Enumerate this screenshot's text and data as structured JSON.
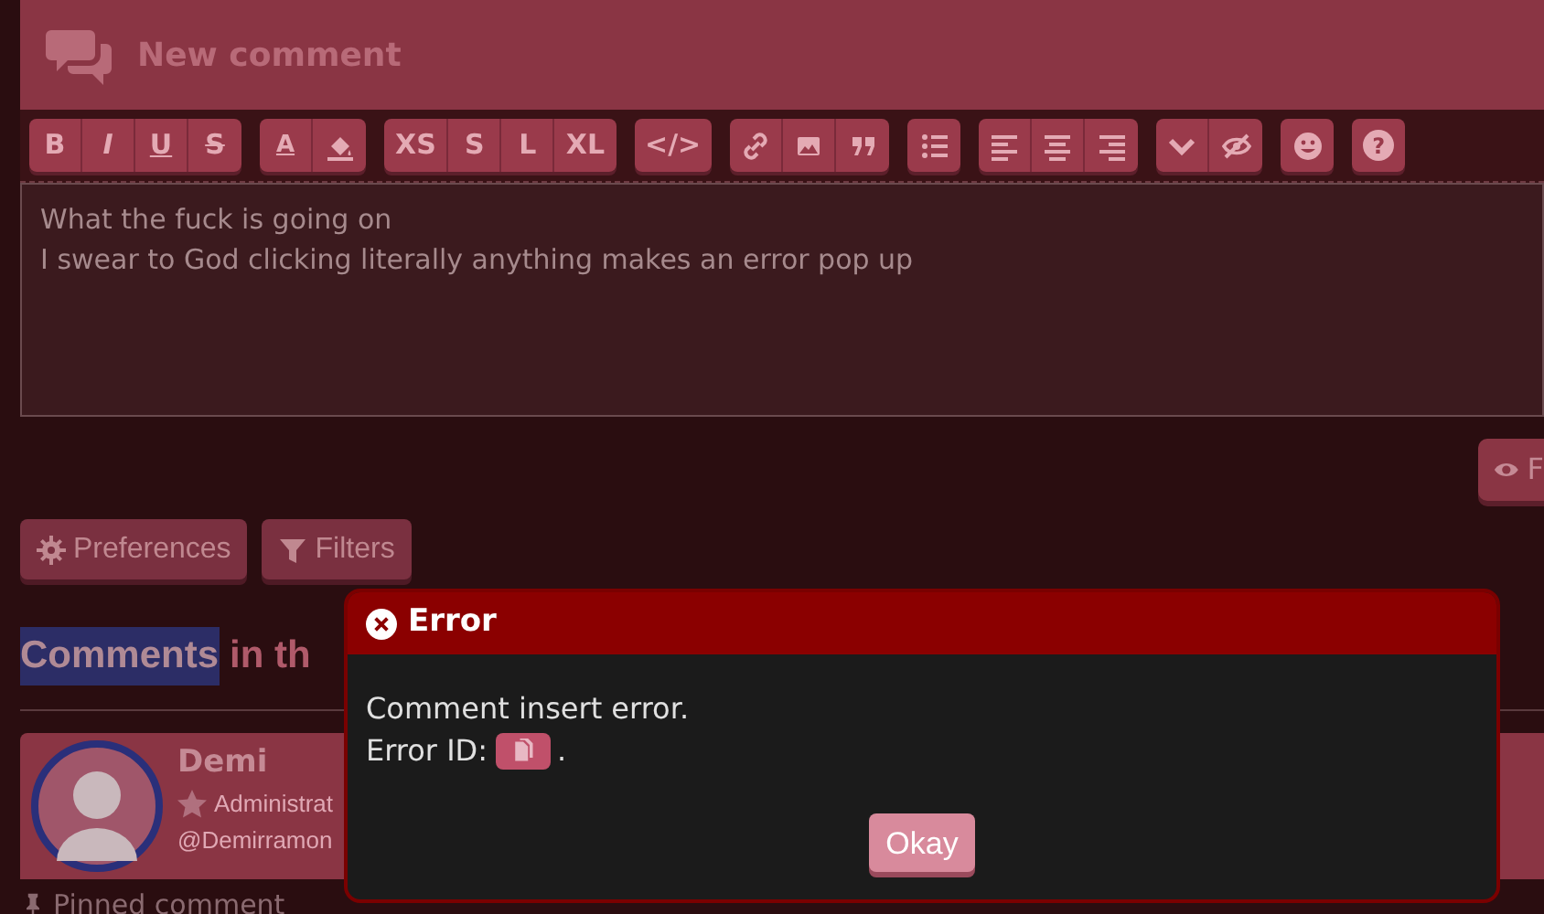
{
  "editor": {
    "title": "New comment",
    "toolbar": [
      [
        {
          "label": "B",
          "kind": "bold"
        },
        {
          "label": "I",
          "kind": "italic"
        },
        {
          "label": "U",
          "kind": "underline"
        },
        {
          "label": "S",
          "kind": "strike"
        }
      ],
      [
        {
          "label": "A",
          "kind": "color"
        },
        {
          "kind": "icon"
        }
      ],
      [
        {
          "label": "XS",
          "kind": "text"
        },
        {
          "label": "S",
          "kind": "text"
        },
        {
          "label": "L",
          "kind": "text"
        },
        {
          "label": "XL",
          "kind": "text"
        }
      ],
      [
        {
          "label": "</>",
          "kind": "text"
        }
      ],
      [
        {
          "kind": "icon"
        },
        {
          "kind": "icon"
        },
        {
          "kind": "icon"
        }
      ],
      [
        {
          "kind": "icon"
        }
      ],
      [
        {
          "kind": "icon"
        },
        {
          "kind": "icon"
        },
        {
          "kind": "icon"
        }
      ],
      [
        {
          "kind": "icon"
        },
        {
          "kind": "icon"
        }
      ],
      [
        {
          "kind": "icon"
        }
      ],
      [
        {
          "label": "?",
          "kind": "circle"
        }
      ]
    ],
    "text": "What the fuck is going on\nI swear to God clicking literally anything makes an error pop up",
    "preview_button": "F"
  },
  "buttons": [
    "Preferences",
    "Filters"
  ],
  "heading": {
    "highlighted": "Comments",
    "rest": "in th"
  },
  "comment": {
    "name": "Demi",
    "role": "Administrat",
    "handle": "@Demirramon"
  },
  "pinned_label": "Pinned comment",
  "dialog": {
    "title": "Error",
    "message": "Comment insert error.",
    "id_label": "Error ID:",
    "id_suffix": ".",
    "button": "Okay"
  }
}
